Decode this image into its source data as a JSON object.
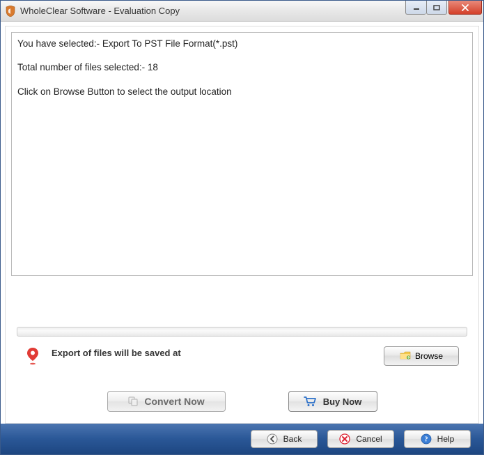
{
  "titlebar": {
    "text": "WholeClear Software - Evaluation Copy"
  },
  "log": {
    "line1": "You have selected:- Export To PST File Format(*.pst)",
    "line2": "Total number of files selected:- 18",
    "line3": "Click on Browse Button to select the output location"
  },
  "browseRow": {
    "label": "Export of files will be saved at",
    "browseBtn": "Browse"
  },
  "actions": {
    "convert": "Convert Now",
    "buy": "Buy Now"
  },
  "footer": {
    "back": "Back",
    "cancel": "Cancel",
    "help": "Help"
  }
}
